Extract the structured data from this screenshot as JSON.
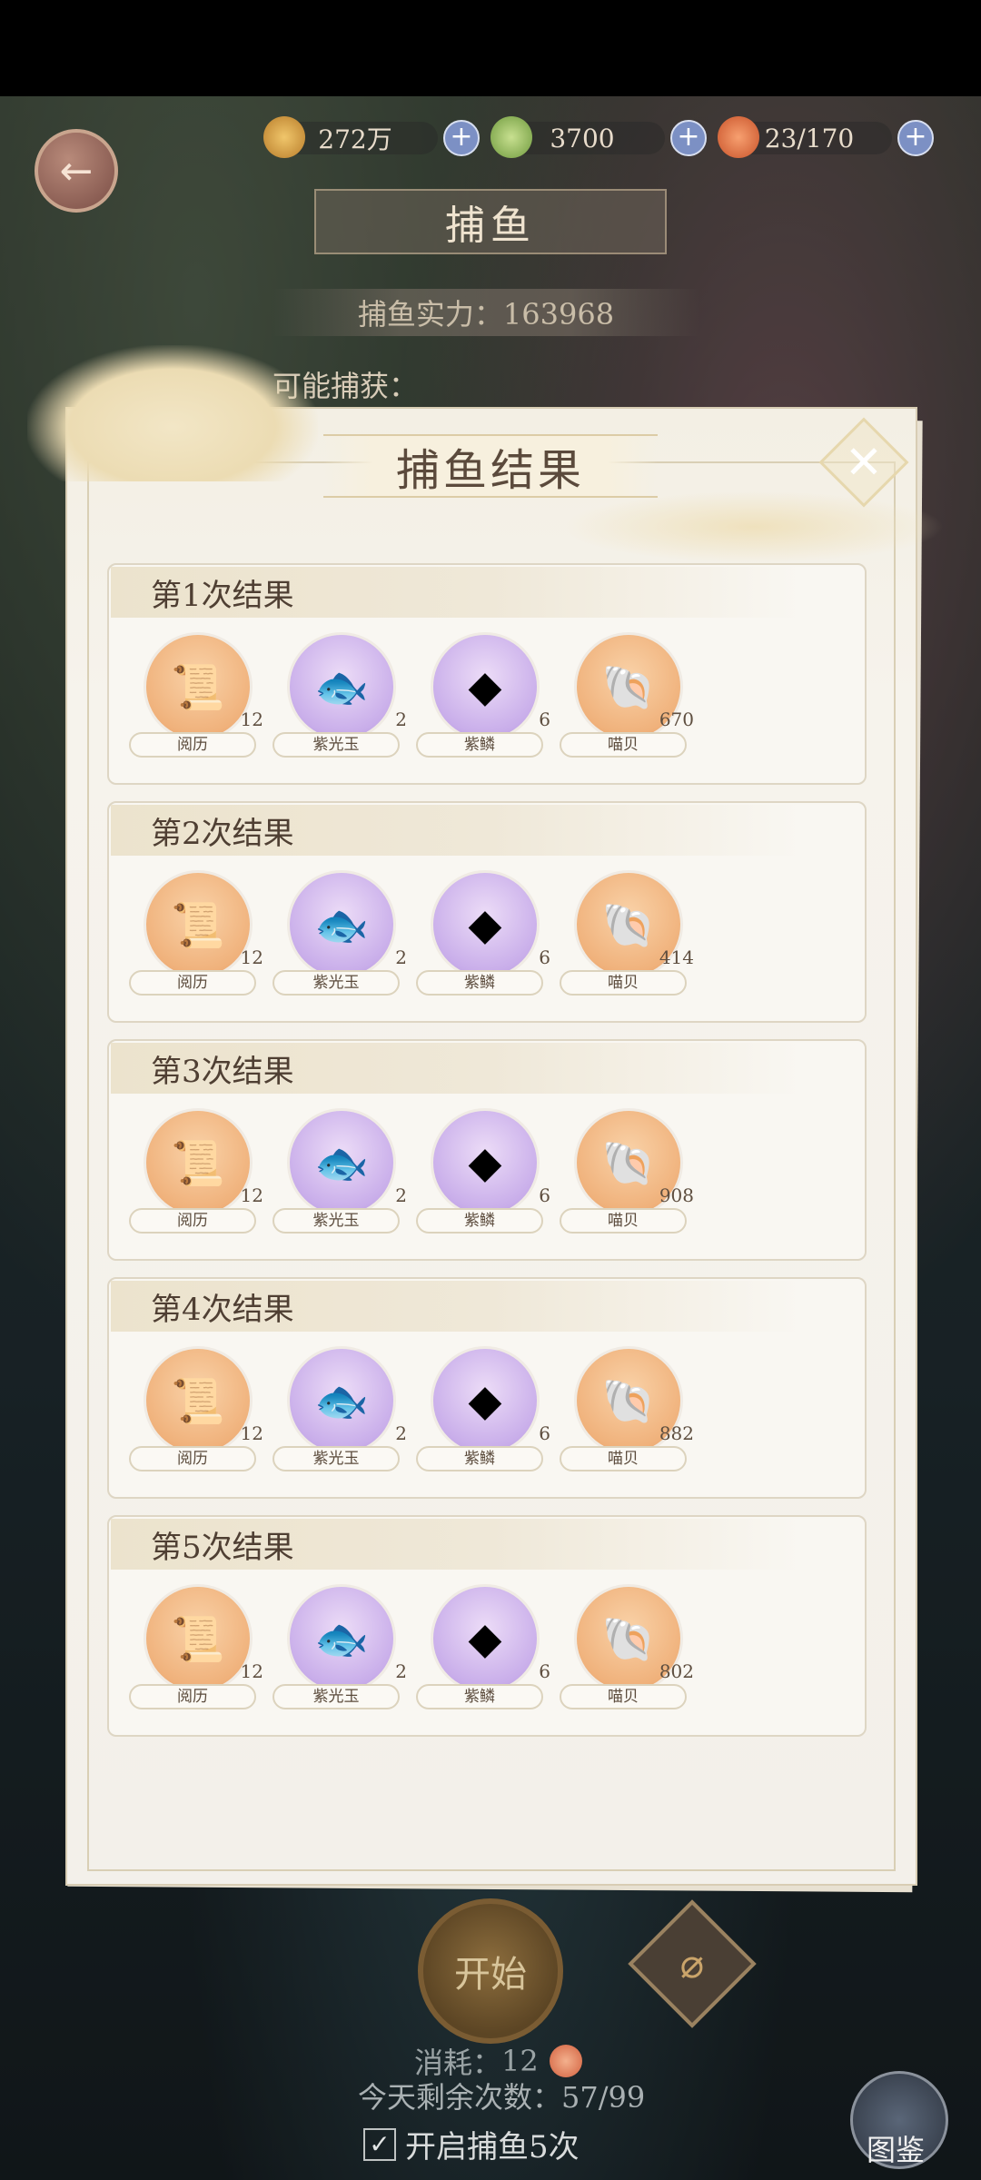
{
  "topbar": {
    "back_icon": "arrow-left-icon",
    "resources": [
      {
        "name": "coin",
        "value": "272万",
        "icon": "paw-coin-icon",
        "color": "#d9a24a"
      },
      {
        "name": "leaf",
        "value": "3700",
        "icon": "leaf-icon",
        "color": "#9bbf6a"
      },
      {
        "name": "stamina",
        "value": "23/170",
        "icon": "orange-orb-icon",
        "color": "#e0703c"
      }
    ]
  },
  "page": {
    "title": "捕鱼",
    "power": "捕鱼实力：163968",
    "may_catch": "可能捕获："
  },
  "dialog": {
    "title": "捕鱼结果",
    "close_icon": "close-icon",
    "results": [
      {
        "title": "第1次结果",
        "items": [
          {
            "name": "阅历",
            "count": "12",
            "icon": "scroll-icon",
            "tone": "gold"
          },
          {
            "name": "紫光玉",
            "count": "2",
            "icon": "purple-fish-jade-icon",
            "tone": "purple"
          },
          {
            "name": "紫鳞",
            "count": "6",
            "icon": "purple-scale-icon",
            "tone": "purple"
          },
          {
            "name": "喵贝",
            "count": "670",
            "icon": "shell-icon",
            "tone": "gold"
          }
        ]
      },
      {
        "title": "第2次结果",
        "items": [
          {
            "name": "阅历",
            "count": "12",
            "icon": "scroll-icon",
            "tone": "gold"
          },
          {
            "name": "紫光玉",
            "count": "2",
            "icon": "purple-fish-jade-icon",
            "tone": "purple"
          },
          {
            "name": "紫鳞",
            "count": "6",
            "icon": "purple-scale-icon",
            "tone": "purple"
          },
          {
            "name": "喵贝",
            "count": "414",
            "icon": "shell-icon",
            "tone": "gold"
          }
        ]
      },
      {
        "title": "第3次结果",
        "items": [
          {
            "name": "阅历",
            "count": "12",
            "icon": "scroll-icon",
            "tone": "gold"
          },
          {
            "name": "紫光玉",
            "count": "2",
            "icon": "purple-fish-jade-icon",
            "tone": "purple"
          },
          {
            "name": "紫鳞",
            "count": "6",
            "icon": "purple-scale-icon",
            "tone": "purple"
          },
          {
            "name": "喵贝",
            "count": "908",
            "icon": "shell-icon",
            "tone": "gold"
          }
        ]
      },
      {
        "title": "第4次结果",
        "items": [
          {
            "name": "阅历",
            "count": "12",
            "icon": "scroll-icon",
            "tone": "gold"
          },
          {
            "name": "紫光玉",
            "count": "2",
            "icon": "purple-fish-jade-icon",
            "tone": "purple"
          },
          {
            "name": "紫鳞",
            "count": "6",
            "icon": "purple-scale-icon",
            "tone": "purple"
          },
          {
            "name": "喵贝",
            "count": "882",
            "icon": "shell-icon",
            "tone": "gold"
          }
        ]
      },
      {
        "title": "第5次结果",
        "items": [
          {
            "name": "阅历",
            "count": "12",
            "icon": "scroll-icon",
            "tone": "gold"
          },
          {
            "name": "紫光玉",
            "count": "2",
            "icon": "purple-fish-jade-icon",
            "tone": "purple"
          },
          {
            "name": "紫鳞",
            "count": "6",
            "icon": "purple-scale-icon",
            "tone": "purple"
          },
          {
            "name": "喵贝",
            "count": "802",
            "icon": "shell-icon",
            "tone": "gold"
          }
        ]
      }
    ]
  },
  "bottom": {
    "start_label": "开始",
    "net_icon": "fishing-net-icon",
    "consume_label": "消耗：",
    "consume_value": "12",
    "remaining_label": "今天剩余次数：57/99",
    "auto_five_label": "开启捕鱼5次",
    "auto_five_checked": true,
    "codex_label": "图鉴",
    "codex_icon": "book-icon"
  }
}
